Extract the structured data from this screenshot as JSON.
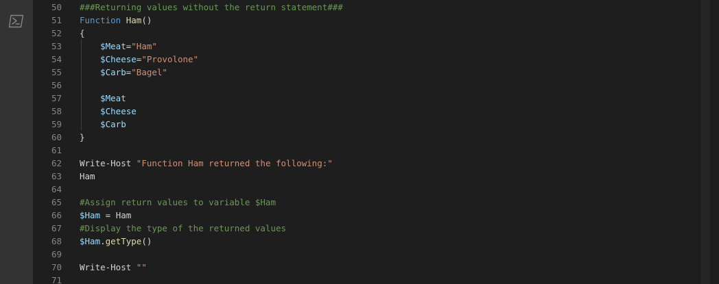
{
  "activity_bar": {
    "icon": "powershell-icon"
  },
  "colors": {
    "background": "#1e1e1e",
    "line_number": "#858585",
    "comment": "#6a9955",
    "keyword": "#569cd6",
    "function_name": "#dcdcaa",
    "variable": "#9cdcfe",
    "string": "#ce9178",
    "plain": "#d4d4d4"
  },
  "lines": [
    {
      "num": "50",
      "tokens": [
        {
          "t": "###Returning values without the return statement###",
          "c": "comment"
        }
      ]
    },
    {
      "num": "51",
      "tokens": [
        {
          "t": "Function",
          "c": "keyword"
        },
        {
          "t": " ",
          "c": "plain"
        },
        {
          "t": "Ham",
          "c": "function_name"
        },
        {
          "t": "()",
          "c": "plain"
        }
      ]
    },
    {
      "num": "52",
      "tokens": [
        {
          "t": "{",
          "c": "plain"
        }
      ]
    },
    {
      "num": "53",
      "tokens": [
        {
          "t": "    ",
          "c": "plain"
        },
        {
          "t": "$Meat",
          "c": "variable"
        },
        {
          "t": "=",
          "c": "plain"
        },
        {
          "t": "\"Ham\"",
          "c": "string"
        }
      ]
    },
    {
      "num": "54",
      "tokens": [
        {
          "t": "    ",
          "c": "plain"
        },
        {
          "t": "$Cheese",
          "c": "variable"
        },
        {
          "t": "=",
          "c": "plain"
        },
        {
          "t": "\"Provolone\"",
          "c": "string"
        }
      ]
    },
    {
      "num": "55",
      "tokens": [
        {
          "t": "    ",
          "c": "plain"
        },
        {
          "t": "$Carb",
          "c": "variable"
        },
        {
          "t": "=",
          "c": "plain"
        },
        {
          "t": "\"Bagel\"",
          "c": "string"
        }
      ]
    },
    {
      "num": "56",
      "tokens": []
    },
    {
      "num": "57",
      "tokens": [
        {
          "t": "    ",
          "c": "plain"
        },
        {
          "t": "$Meat",
          "c": "variable"
        }
      ]
    },
    {
      "num": "58",
      "tokens": [
        {
          "t": "    ",
          "c": "plain"
        },
        {
          "t": "$Cheese",
          "c": "variable"
        }
      ]
    },
    {
      "num": "59",
      "tokens": [
        {
          "t": "    ",
          "c": "plain"
        },
        {
          "t": "$Carb",
          "c": "variable"
        }
      ]
    },
    {
      "num": "60",
      "tokens": [
        {
          "t": "}",
          "c": "plain"
        }
      ]
    },
    {
      "num": "61",
      "tokens": []
    },
    {
      "num": "62",
      "tokens": [
        {
          "t": "Write-Host",
          "c": "plain"
        },
        {
          "t": " ",
          "c": "plain"
        },
        {
          "t": "\"Function Ham returned the following:\"",
          "c": "string"
        }
      ]
    },
    {
      "num": "63",
      "tokens": [
        {
          "t": "Ham",
          "c": "plain"
        }
      ]
    },
    {
      "num": "64",
      "tokens": []
    },
    {
      "num": "65",
      "tokens": [
        {
          "t": "#Assign return values to variable $Ham",
          "c": "comment"
        }
      ]
    },
    {
      "num": "66",
      "tokens": [
        {
          "t": "$Ham",
          "c": "variable"
        },
        {
          "t": " = ",
          "c": "plain"
        },
        {
          "t": "Ham",
          "c": "plain"
        }
      ]
    },
    {
      "num": "67",
      "tokens": [
        {
          "t": "#Display the type of the returned values",
          "c": "comment"
        }
      ]
    },
    {
      "num": "68",
      "tokens": [
        {
          "t": "$Ham",
          "c": "variable"
        },
        {
          "t": ".",
          "c": "plain"
        },
        {
          "t": "getType",
          "c": "function_name"
        },
        {
          "t": "()",
          "c": "plain"
        }
      ]
    },
    {
      "num": "69",
      "tokens": []
    },
    {
      "num": "70",
      "tokens": [
        {
          "t": "Write-Host",
          "c": "plain"
        },
        {
          "t": " ",
          "c": "plain"
        },
        {
          "t": "\"\"",
          "c": "string"
        }
      ]
    },
    {
      "num": "71",
      "tokens": []
    }
  ]
}
